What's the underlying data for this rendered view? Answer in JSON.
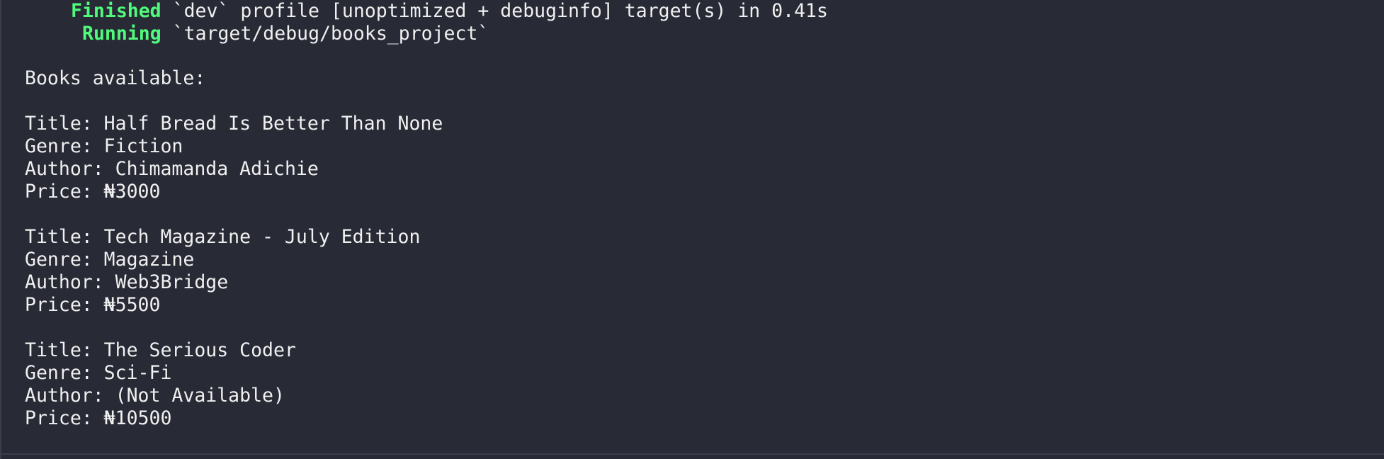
{
  "colors": {
    "background": "#282a36",
    "text": "#f0f0f0",
    "status_green": "#50fa7b"
  },
  "build": {
    "finished_label": "Finished",
    "finished_detail": "`dev` profile [unoptimized + debuginfo] target(s) in 0.41s",
    "running_label": "Running",
    "running_detail": "`target/debug/books_project`"
  },
  "output": {
    "heading": "Books available:",
    "books": [
      {
        "title": "Title: Half Bread Is Better Than None",
        "genre": "Genre: Fiction",
        "author": "Author: Chimamanda Adichie",
        "price": "Price: ₦3000"
      },
      {
        "title": "Title: Tech Magazine - July Edition",
        "genre": "Genre: Magazine",
        "author": "Author: Web3Bridge",
        "price": "Price: ₦5500"
      },
      {
        "title": "Title: The Serious Coder",
        "genre": "Genre: Sci-Fi",
        "author": "Author: (Not Available)",
        "price": "Price: ₦10500"
      }
    ]
  }
}
